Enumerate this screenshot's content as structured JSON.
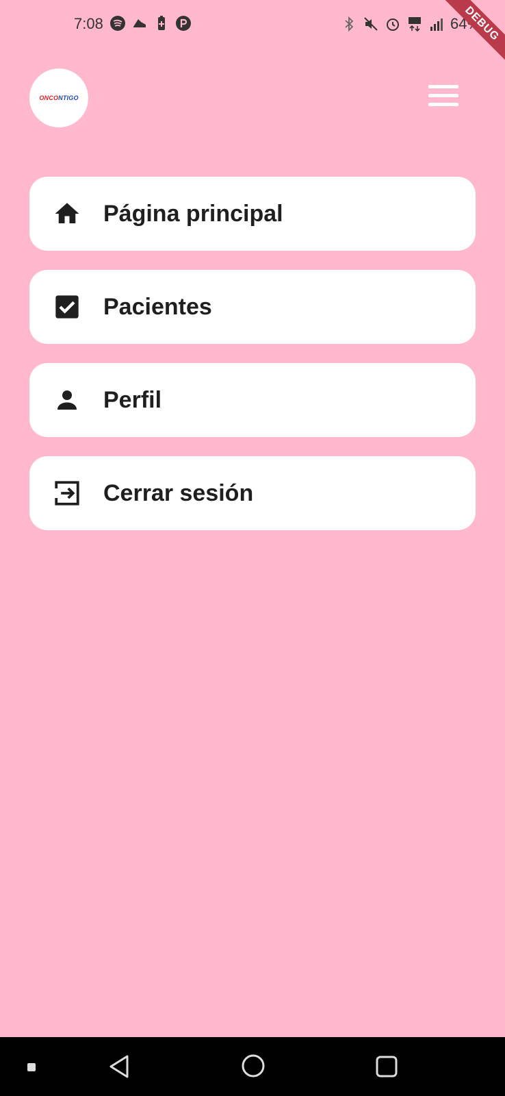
{
  "status_bar": {
    "time": "7:08",
    "battery": "64%",
    "icons_left": [
      "spotify-icon",
      "shoe-icon",
      "battery-saver-icon",
      "p-circle-icon"
    ],
    "icons_right": [
      "bluetooth-icon",
      "mute-vibrate-icon",
      "alarm-icon",
      "data-4g-icon",
      "signal-icon"
    ]
  },
  "debug_banner": "DEBUG",
  "header": {
    "logo_text_part1": "ONCO",
    "logo_text_part2": "NTIGO",
    "menu_icon": "hamburger-icon"
  },
  "menu": {
    "items": [
      {
        "label": "Página principal",
        "icon": "home-icon"
      },
      {
        "label": "Pacientes",
        "icon": "checkbox-icon"
      },
      {
        "label": "Perfil",
        "icon": "person-icon"
      },
      {
        "label": "Cerrar sesión",
        "icon": "logout-icon"
      }
    ]
  },
  "nav_bar": {
    "buttons": [
      "back-icon",
      "home-circle-icon",
      "recents-icon"
    ]
  },
  "colors": {
    "background": "#ffb8cc",
    "card": "#ffffff",
    "text": "#1f1f1f",
    "debug": "#b83a4b"
  }
}
